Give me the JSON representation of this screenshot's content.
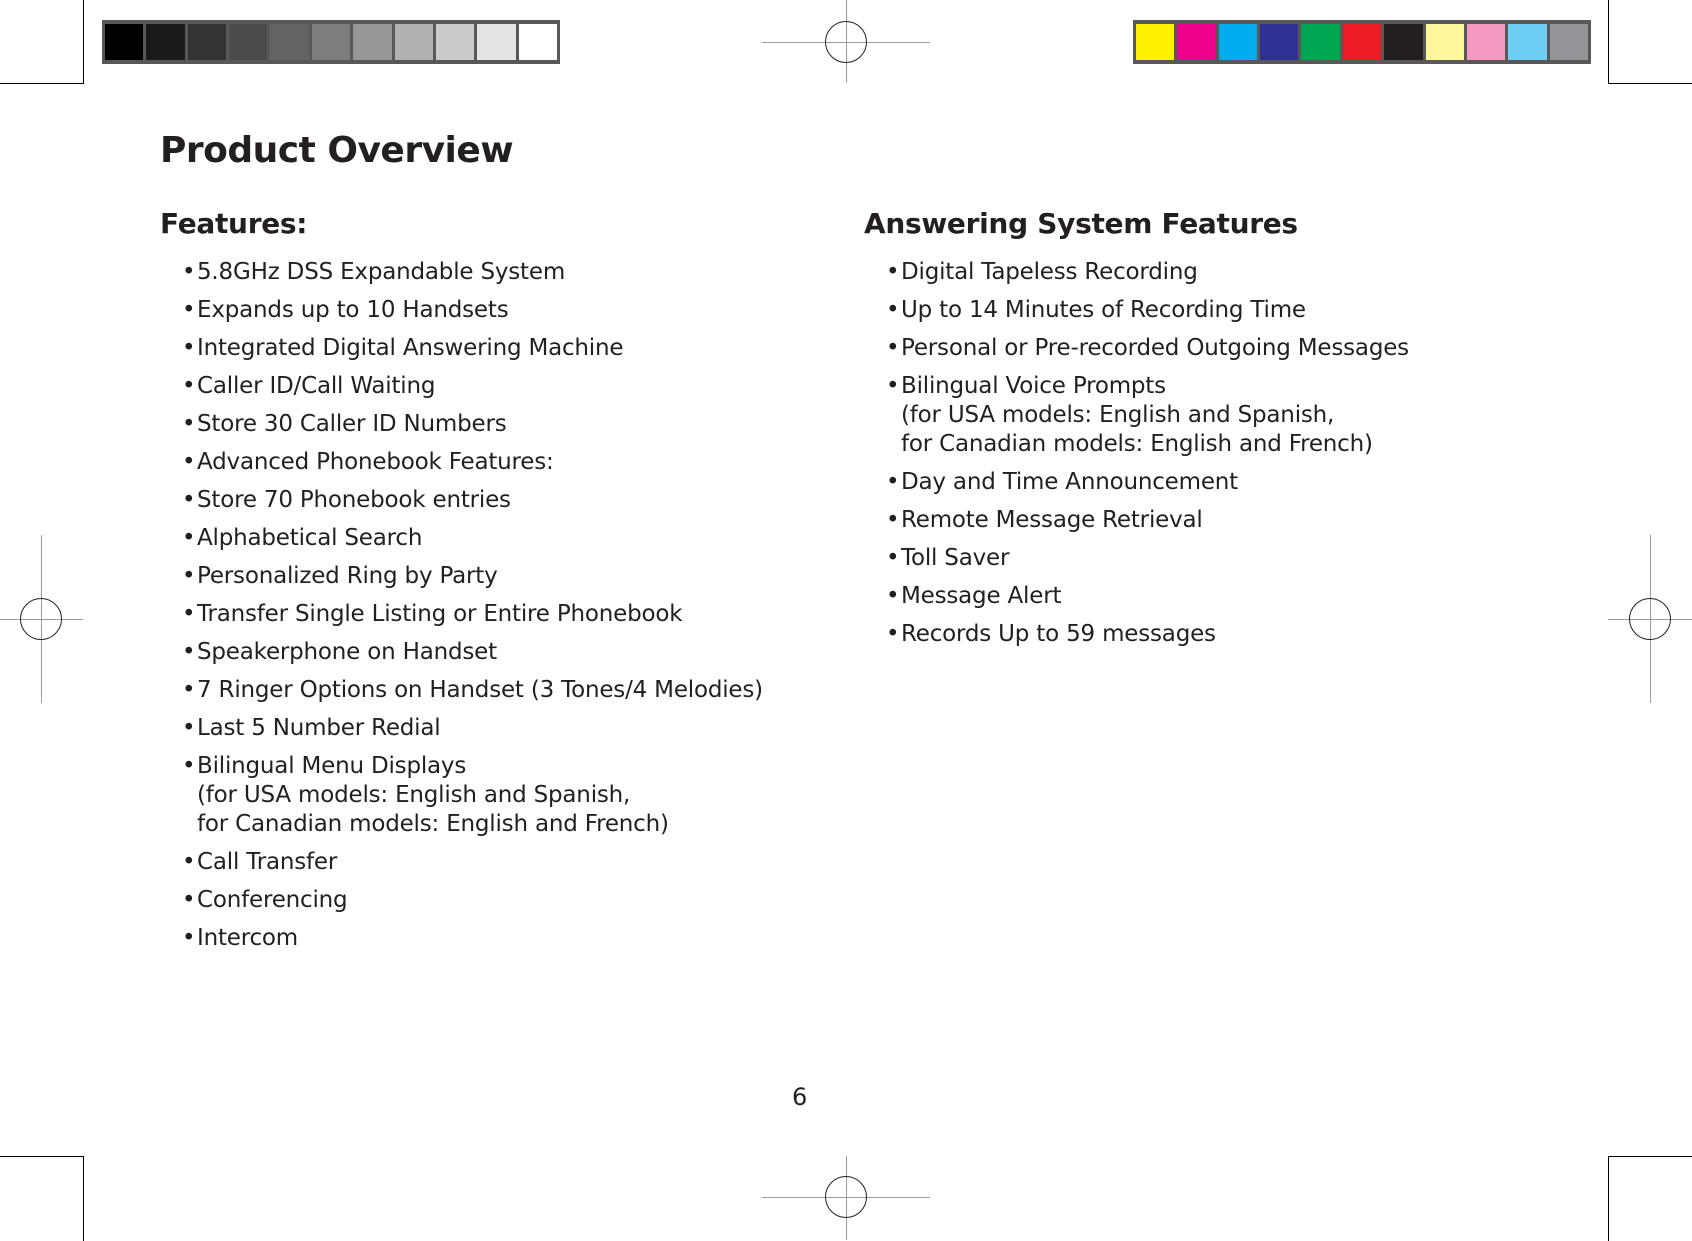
{
  "print_marks": {
    "grayscale_swatches": [
      "#000000",
      "#1a1a1a",
      "#333333",
      "#4b4b4b",
      "#646464",
      "#7d7d7d",
      "#979797",
      "#b1b1b1",
      "#cbcbcb",
      "#e4e4e4",
      "#ffffff"
    ],
    "color_swatches": [
      "#fff200",
      "#ec008c",
      "#00aeef",
      "#2e3192",
      "#00a651",
      "#ed1c24",
      "#231f20",
      "#fff799",
      "#f49ac1",
      "#6dcff6",
      "#939598"
    ],
    "registration_icon": "registration-crosshair-icon",
    "crop_icon": "crop-mark-icon"
  },
  "page": {
    "title": "Product Overview",
    "page_number": "6"
  },
  "features": {
    "heading": "Features:",
    "items": [
      {
        "text": "5.8GHz DSS Expandable System"
      },
      {
        "text": "Expands up to 10 Handsets"
      },
      {
        "text": "Integrated Digital Answering Machine"
      },
      {
        "text": "Caller ID/Call Waiting"
      },
      {
        "text": "Store 30 Caller ID Numbers"
      },
      {
        "text": "Advanced Phonebook Features:"
      },
      {
        "text": "Store 70 Phonebook entries"
      },
      {
        "text": "Alphabetical Search"
      },
      {
        "text": "Personalized Ring by Party"
      },
      {
        "text": "Transfer Single Listing or Entire Phonebook"
      },
      {
        "text": "Speakerphone on Handset"
      },
      {
        "text": "7 Ringer Options on Handset (3 Tones/4 Melodies)"
      },
      {
        "text": "Last 5 Number Redial"
      },
      {
        "text": "Bilingual Menu Displays",
        "sub1": "(for USA models: English and Spanish,",
        "sub2": "for Canadian models: English and French)"
      },
      {
        "text": "Call Transfer"
      },
      {
        "text": "Conferencing"
      },
      {
        "text": "Intercom"
      }
    ]
  },
  "answering": {
    "heading": "Answering System Features",
    "items": [
      {
        "text": "Digital Tapeless Recording"
      },
      {
        "text": "Up to 14 Minutes of Recording Time"
      },
      {
        "text": "Personal or Pre-recorded Outgoing Messages"
      },
      {
        "text": "Bilingual Voice Prompts",
        "sub1": "(for USA models: English and Spanish,",
        "sub2": "for Canadian models: English and French)"
      },
      {
        "text": "Day and Time Announcement"
      },
      {
        "text": "Remote Message Retrieval"
      },
      {
        "text": "Toll Saver"
      },
      {
        "text": "Message Alert"
      },
      {
        "text": "Records Up to 59 messages"
      }
    ]
  },
  "bullet_glyph": "•"
}
